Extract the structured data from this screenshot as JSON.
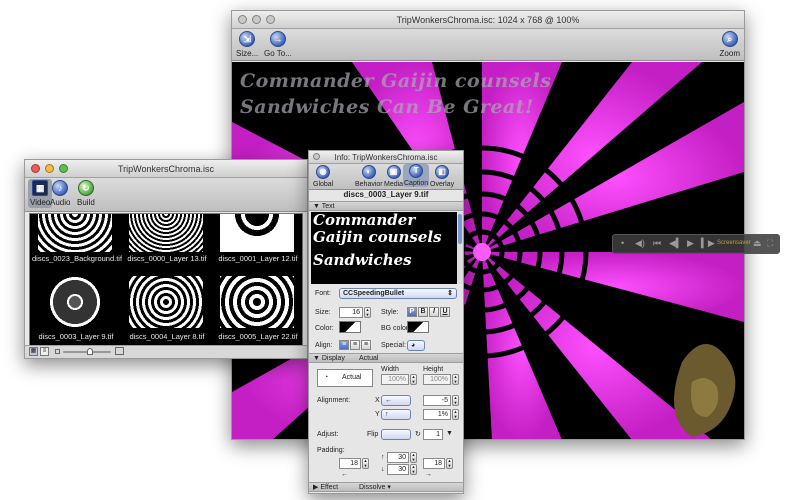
{
  "main_window": {
    "title": "TripWonkersChroma.isc: 1024 x 768 @ 100%",
    "toolbar": {
      "size_label": "Size...",
      "goto_label": "Go To...",
      "zoom_label": "Zoom"
    },
    "caption_line1": "Commander Gaijin counsels",
    "caption_line2": "Sandwiches Can Be Great!"
  },
  "hud": {
    "screensaver_label": "Screensaver"
  },
  "browser_window": {
    "title": "TripWonkersChroma.isc",
    "toolbar": {
      "video_label": "Video",
      "audio_label": "Audio",
      "build_label": "Build"
    },
    "thumbnails": [
      {
        "label": "discs_0023_Background.tif"
      },
      {
        "label": "discs_0000_Layer 13.tif"
      },
      {
        "label": "discs_0001_Layer 12.tif"
      },
      {
        "label": "discs_0003_Layer 9.tif"
      },
      {
        "label": "discs_0004_Layer 8.tif"
      },
      {
        "label": "discs_0005_Layer 22.tif"
      }
    ]
  },
  "info_panel": {
    "title": "Info: TripWonkersChroma.isc",
    "toolbar": {
      "global": "Global",
      "behavior": "Behavior",
      "media": "Media",
      "caption": "Caption",
      "overlay": "Overlay"
    },
    "filename": "discs_0003_Layer 9.tif",
    "text_section": "Text",
    "preview_line1": "Commander",
    "preview_line2": "Gaijin counsels",
    "preview_line3": "Sandwiches",
    "font_label": "Font:",
    "font_value": "CCSpeedingBullet",
    "size_label": "Size:",
    "size_value": "16",
    "style_label": "Style:",
    "style_p": "P",
    "style_b": "B",
    "style_i": "I",
    "style_u": "U",
    "color_label": "Color:",
    "bgcolor_label": "BG color:",
    "align_label": "Align:",
    "special_label": "Special:",
    "display_section": "Display",
    "display_mode": "Actual",
    "display_popup": "Actual",
    "width_label": "Width",
    "height_label": "Height",
    "width_value": "100%",
    "height_value": "100%",
    "alignment_label": "Alignment:",
    "x_label": "X",
    "y_label": "Y",
    "x_value": "-5",
    "y_value": "1%",
    "adjust_label": "Adjust:",
    "flip_label": "Flip",
    "rotate_value": "1",
    "padding_label": "Padding:",
    "pad_top": "30",
    "pad_left": "18",
    "pad_right": "18",
    "pad_bottom": "30",
    "effect_section": "Effect",
    "effect_value": "Dissolve"
  }
}
